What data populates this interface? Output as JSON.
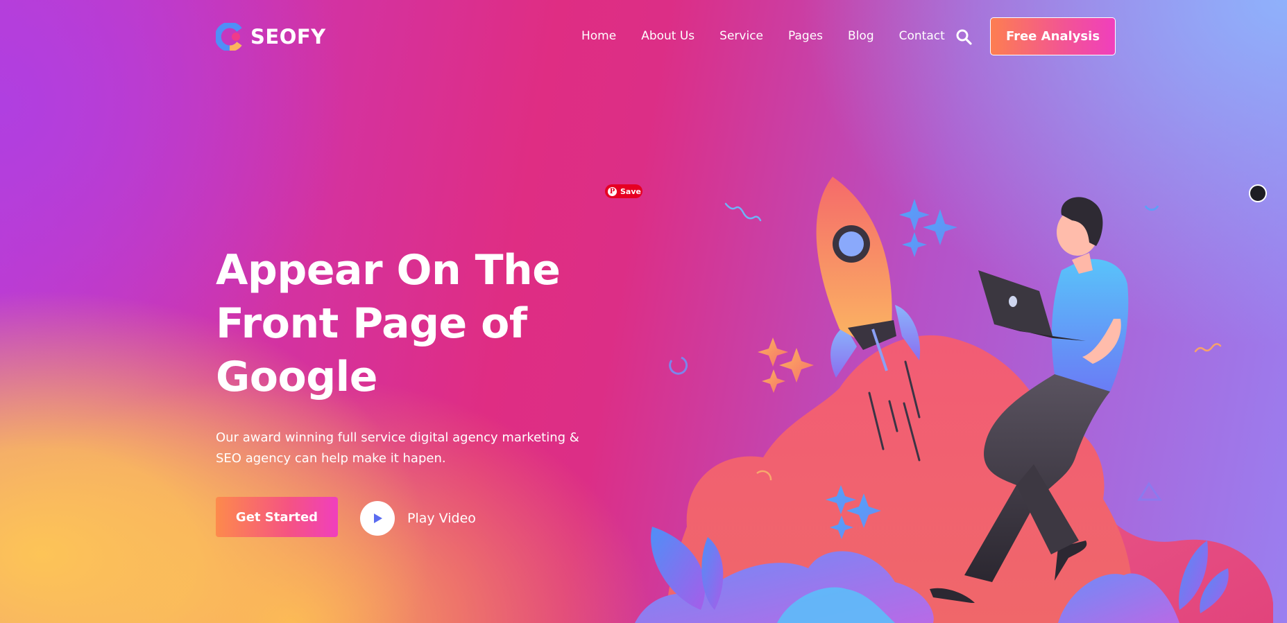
{
  "brand": {
    "name": "SEOFY",
    "logo_icon": "seofy-logo-icon"
  },
  "nav": {
    "items": [
      {
        "label": "Home"
      },
      {
        "label": "About Us"
      },
      {
        "label": "Service"
      },
      {
        "label": "Pages"
      },
      {
        "label": "Blog"
      },
      {
        "label": "Contact"
      }
    ],
    "search_icon": "search-icon",
    "cta_label": "Free Analysis"
  },
  "hero": {
    "title_lines": [
      "Appear On The",
      "Front Page of",
      "Google"
    ],
    "subtitle_line1": "Our award winning full service digital agency marketing &",
    "subtitle_line2": "SEO agency can help make it hapen.",
    "primary_button": "Get Started",
    "play_label": "Play Video"
  },
  "overlays": {
    "pinterest_save": "Save",
    "lens_icon": "visual-search-icon"
  },
  "colors": {
    "accent_orange": "#fd7e51",
    "accent_pink": "#f03fbd",
    "play_icon": "#5b6cf0"
  }
}
